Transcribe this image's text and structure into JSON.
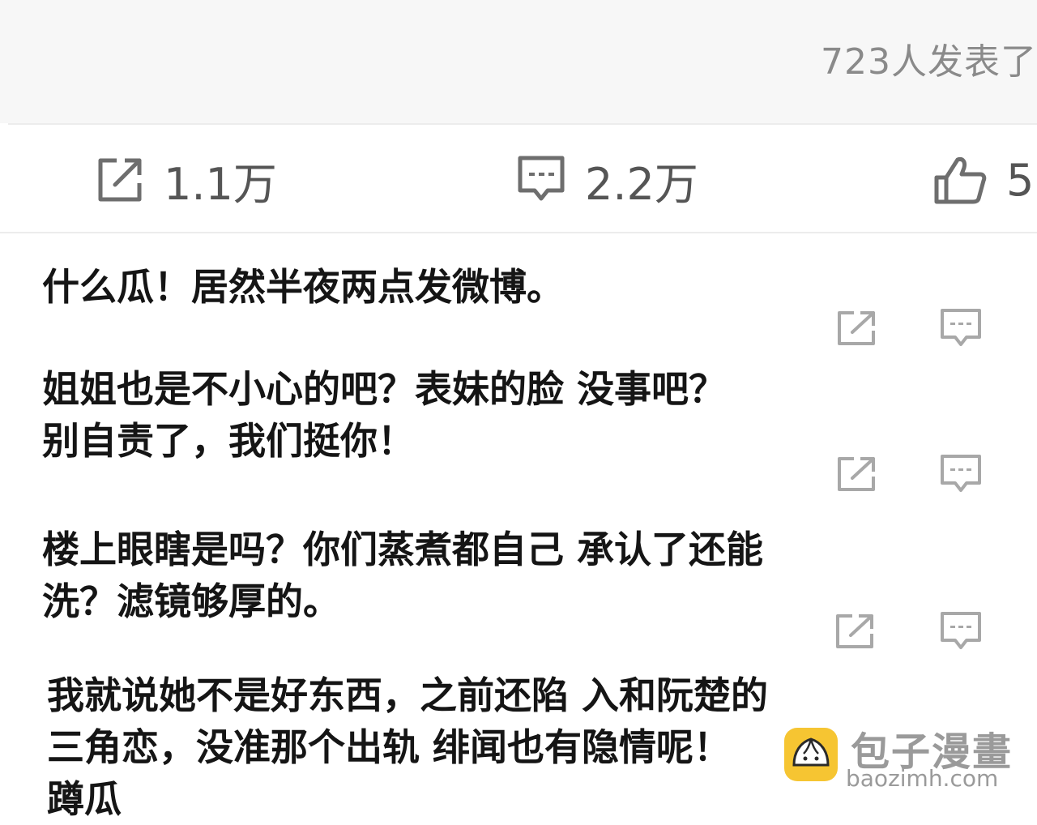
{
  "header": {
    "participants_text": "723人发表了"
  },
  "actions": {
    "repost_count": "1.1万",
    "comment_count": "2.2万",
    "like_count": "5"
  },
  "comments": [
    {
      "lines": [
        "什么瓜！居然半夜两点发微博。"
      ]
    },
    {
      "lines": [
        "姐姐也是不小心的吧？表妹的脸 没事吧？",
        "别自责了，我们挺你！"
      ]
    },
    {
      "lines": [
        "楼上眼瞎是吗？你们蒸煮都自己 承认了还能",
        "洗？滤镜够厚的。"
      ]
    },
    {
      "lines": [
        "我就说她不是好东西，之前还陷 入和阮楚的",
        "三角恋，没准那个出轨 绯闻也有隐情呢！",
        "蹲瓜"
      ]
    }
  ],
  "watermark": {
    "title": "包子漫畫",
    "url": "baozimh.com"
  },
  "colors": {
    "icon_gray": "#6e6e6e",
    "mini_icon_gray": "#a8a8a8",
    "text": "#151515",
    "logo_yellow": "#f6c532"
  }
}
